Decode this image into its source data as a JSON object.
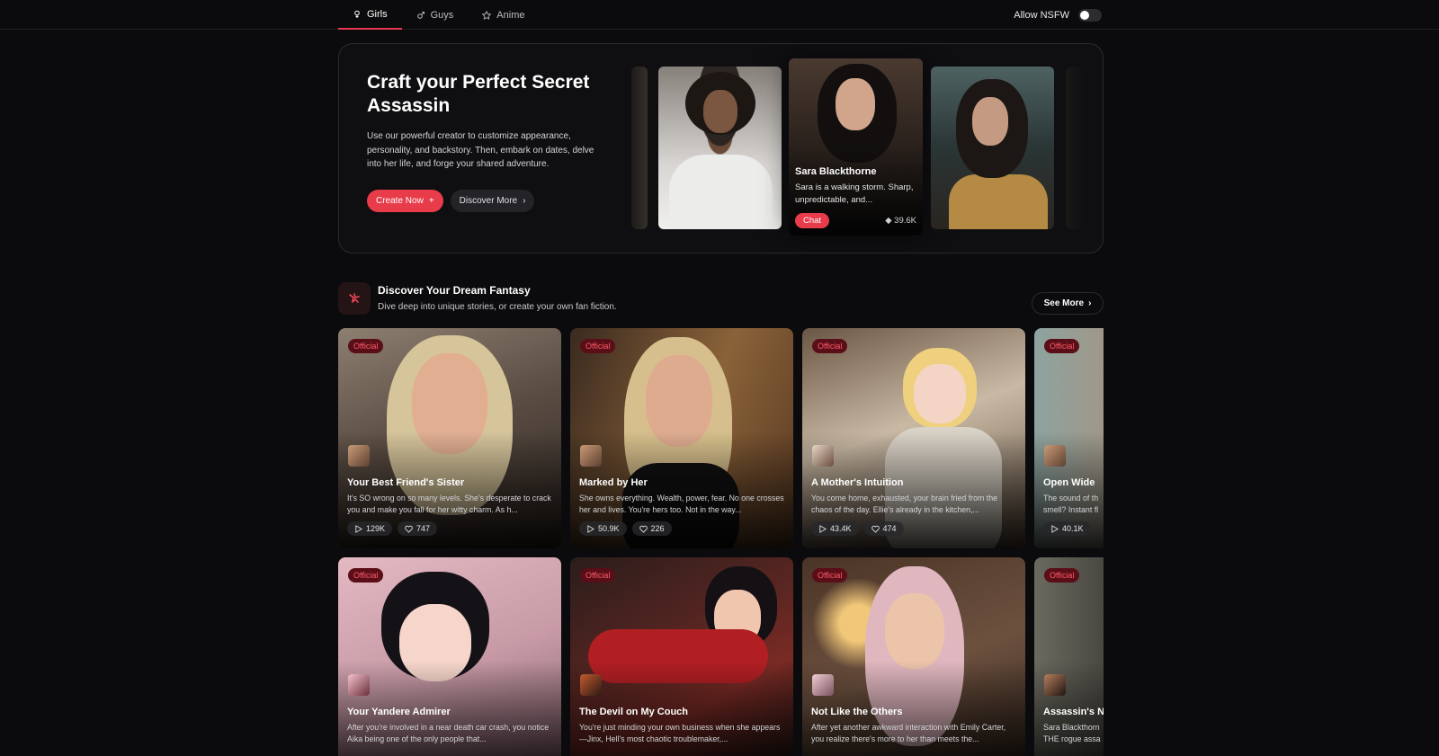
{
  "nav": {
    "tabs": [
      {
        "label": "Girls",
        "icon": "female-icon",
        "active": true
      },
      {
        "label": "Guys",
        "icon": "male-icon",
        "active": false
      },
      {
        "label": "Anime",
        "icon": "star-icon",
        "active": false
      }
    ],
    "nsfw_label": "Allow NSFW",
    "nsfw_enabled": false
  },
  "hero": {
    "title": "Craft your Perfect Secret Assassin",
    "description": "Use our powerful creator to customize appearance, personality, and backstory. Then, embark on dates, delve into her life, and forge your shared adventure.",
    "create_label": "Create Now",
    "discover_label": "Discover More",
    "featured": {
      "name": "Sara Blackthorne",
      "description": "Sara is a walking storm. Sharp, unpredictable, and...",
      "chat_label": "Chat",
      "count": "39.6K"
    }
  },
  "section": {
    "title": "Discover Your Dream Fantasy",
    "subtitle": "Dive deep into unique stories, or create your own fan fiction.",
    "see_more_label": "See More"
  },
  "cards": [
    {
      "badge": "Official",
      "title": "Your Best Friend's Sister",
      "description": "It's SO wrong on so many levels. She's desperate to crack you and make you fall for her witty charm. As h...",
      "plays": "129K",
      "likes": "747"
    },
    {
      "badge": "Official",
      "title": "Marked by Her",
      "description": "She owns everything. Wealth, power, fear. No one crosses her and lives. You're hers too. Not in the way...",
      "plays": "50.9K",
      "likes": "226"
    },
    {
      "badge": "Official",
      "title": "A Mother's Intuition",
      "description": "You come home, exhausted, your brain fried from the chaos of the day. Ellie's already in the kitchen,...",
      "plays": "43.4K",
      "likes": "474"
    },
    {
      "badge": "Official",
      "title": "Open Wide",
      "description": "The sound of th smell? Instant fl",
      "plays": "40.1K",
      "likes": ""
    },
    {
      "badge": "Official",
      "title": "Your Yandere Admirer",
      "description": "After you're involved in a near death car crash, you notice Aika being one of the only people that...",
      "plays": "",
      "likes": ""
    },
    {
      "badge": "Official",
      "title": "The Devil on My Couch",
      "description": "You're just minding your own business when she appears—Jinx, Hell's most chaotic troublemaker,...",
      "plays": "",
      "likes": ""
    },
    {
      "badge": "Official",
      "title": "Not Like the Others",
      "description": "After yet another awkward interaction with Emily Carter, you realize there's more to her than meets the...",
      "plays": "",
      "likes": ""
    },
    {
      "badge": "Official",
      "title": "Assassin's N",
      "description": "Sara Blackthorn THE rogue assa",
      "plays": "",
      "likes": ""
    }
  ]
}
